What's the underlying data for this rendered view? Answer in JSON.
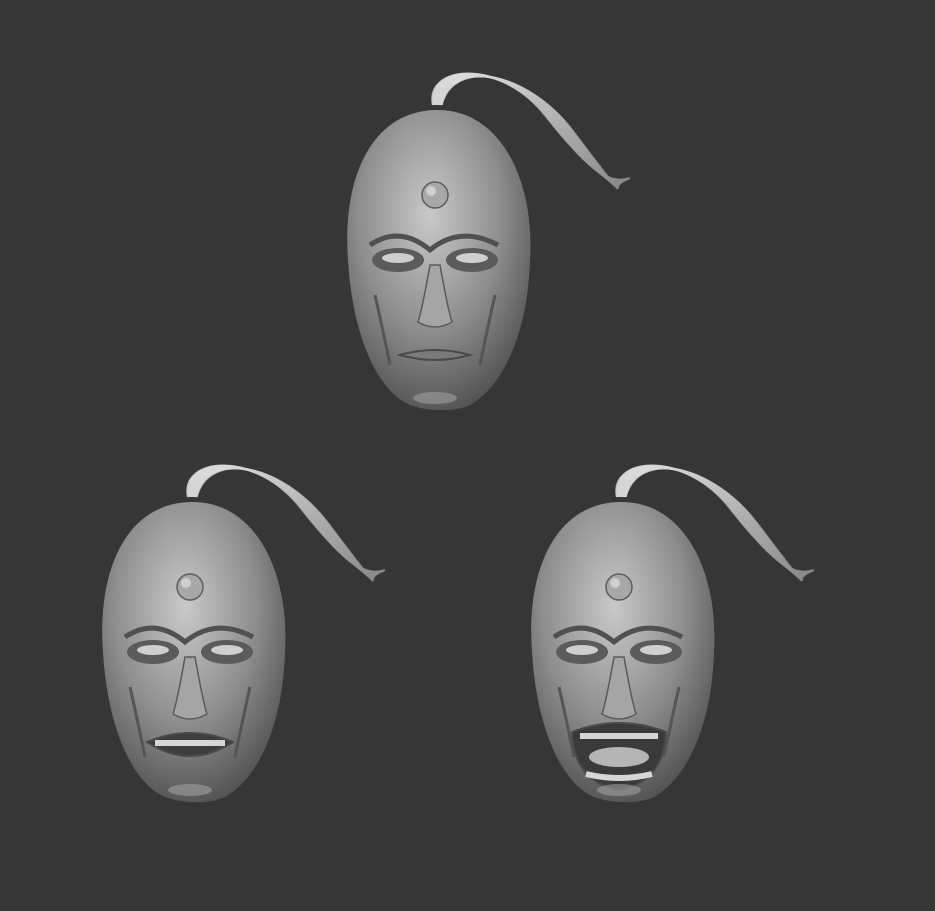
{
  "scene": {
    "background_color": "#363636",
    "subject": "3D sculpt heads",
    "head_count": 3
  },
  "heads": [
    {
      "expression": "neutral",
      "mouth": "closed"
    },
    {
      "expression": "snarl",
      "mouth": "teeth-clenched"
    },
    {
      "expression": "roar",
      "mouth": "open"
    }
  ],
  "colors": {
    "skin_light": "#c9c9c9",
    "skin_mid": "#8e8e8e",
    "skin_dark": "#4d4d4d",
    "hair": "#bdbdbd"
  }
}
